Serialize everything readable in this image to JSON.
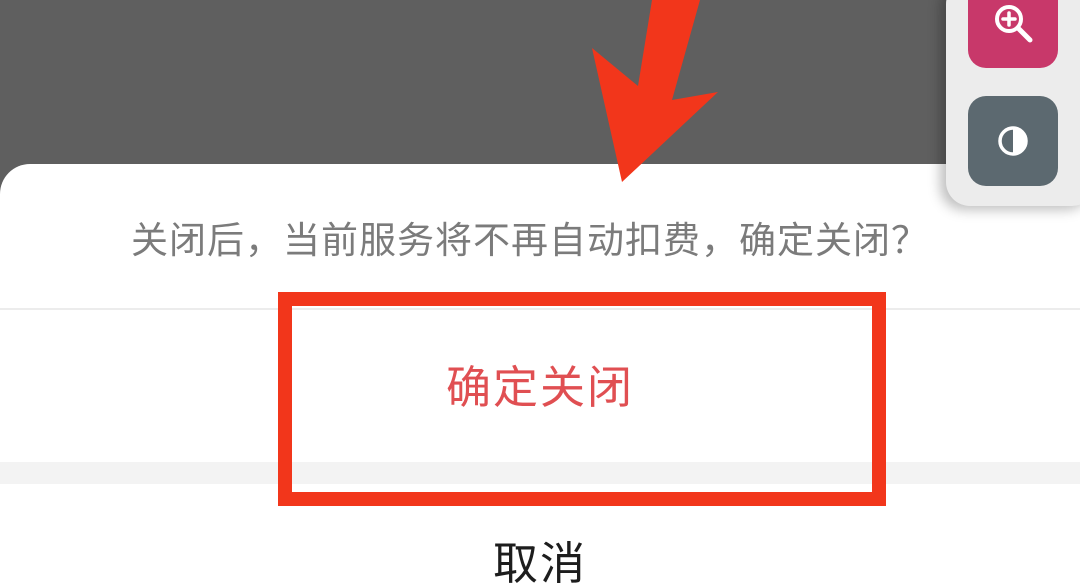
{
  "dialog": {
    "message": "关闭后，当前服务将不再自动扣费，确定关闭？",
    "confirm_label": "确定关闭",
    "cancel_label": "取消"
  },
  "floating_tools": {
    "zoom_icon": "zoom-in-icon",
    "contrast_icon": "contrast-icon"
  },
  "colors": {
    "confirm_text": "#e04f52",
    "annotation_red": "#f2361b",
    "overlay": "#5f5f5f",
    "zoom_button": "#c8386a",
    "contrast_button": "#5c6970"
  }
}
